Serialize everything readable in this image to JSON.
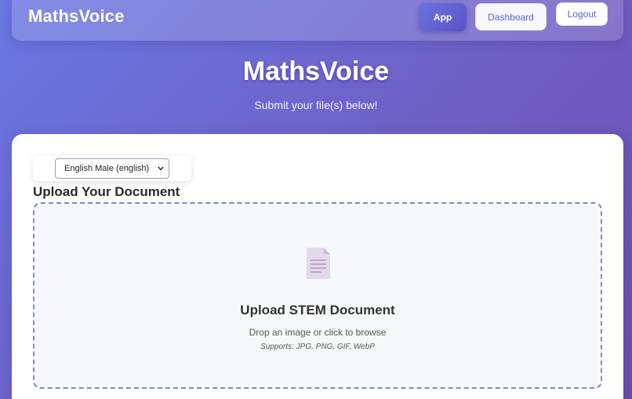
{
  "navbar": {
    "brand": "MathsVoice",
    "items": [
      {
        "label": "App",
        "active": true
      },
      {
        "label": "Dashboard",
        "active": false
      },
      {
        "label": "Logout",
        "active": false
      }
    ]
  },
  "hero": {
    "title": "MathsVoice",
    "subtitle": "Submit your file(s) below!"
  },
  "voice_select": {
    "selected": "English Male (english)",
    "icon": "chevron-down-icon"
  },
  "upload": {
    "heading": "Upload Your Document",
    "dropzone": {
      "icon": "document-icon",
      "title": "Upload STEM Document",
      "hint": "Drop an image or click to browse",
      "supports": "Supports: JPG, PNG, GIF, WebP"
    }
  },
  "colors": {
    "accent": "#5a63c8",
    "background_start": "#6a77e2",
    "background_end": "#6c4fb3",
    "dropzone_border": "#7e8ac7"
  }
}
